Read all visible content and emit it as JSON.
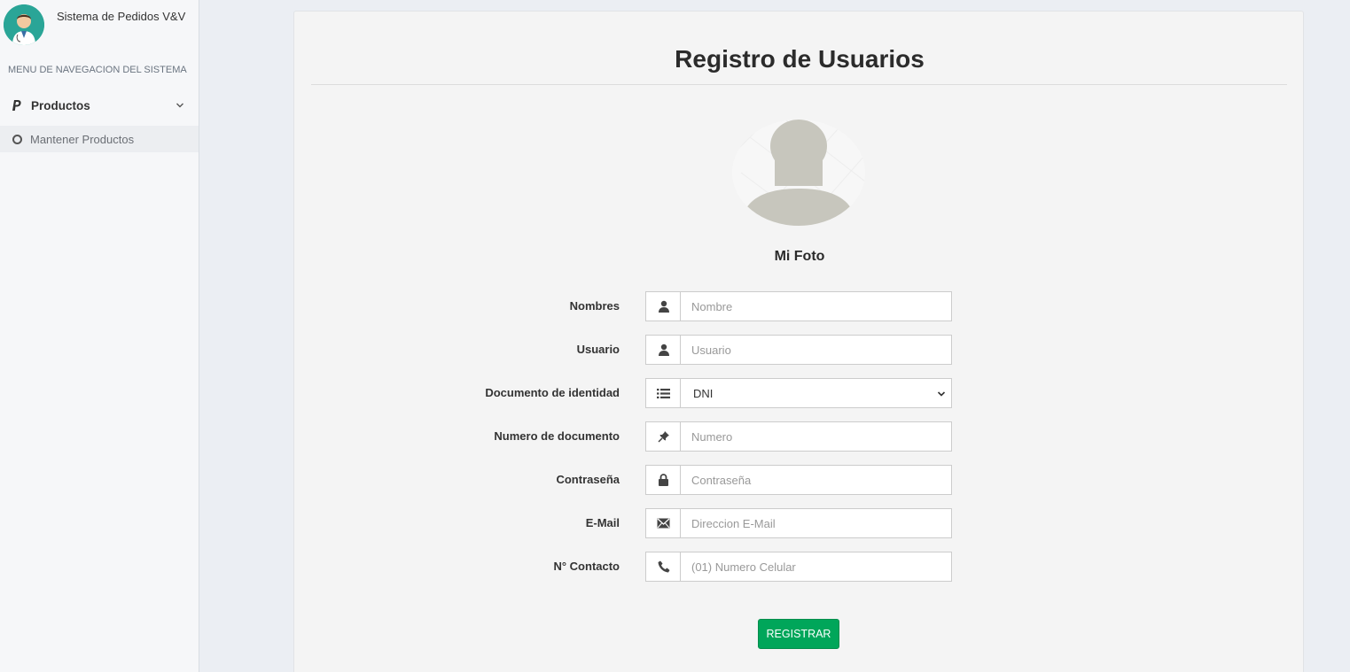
{
  "sidebar": {
    "brand_title": "Sistema de Pedidos V&V",
    "nav_header": "MENU DE NAVEGACION DEL SISTEMA",
    "menu_label": "Productos",
    "menu_icon": "paypal-icon",
    "submenu_label": "Mantener Productos"
  },
  "page": {
    "title": "Registro de Usuarios",
    "photo_caption": "Mi Foto"
  },
  "form": {
    "fields": [
      {
        "label": "Nombres",
        "placeholder": "Nombre",
        "icon": "user-icon"
      },
      {
        "label": "Usuario",
        "placeholder": "Usuario",
        "icon": "user-icon"
      },
      {
        "label": "Documento de identidad",
        "selected": "DNI",
        "icon": "list-icon"
      },
      {
        "label": "Numero de documento",
        "placeholder": "Numero",
        "icon": "pushpin-icon"
      },
      {
        "label": "Contraseña",
        "placeholder": "Contraseña",
        "icon": "lock-icon"
      },
      {
        "label": "E-Mail",
        "placeholder": "Direccion E-Mail",
        "icon": "envelope-icon"
      },
      {
        "label": "N° Contacto",
        "placeholder": "(01) Numero Celular",
        "icon": "phone-icon"
      }
    ],
    "submit_label": "REGISTRAR"
  },
  "colors": {
    "submit_bg": "#00a65a",
    "avatar_bg": "#2aa597"
  }
}
